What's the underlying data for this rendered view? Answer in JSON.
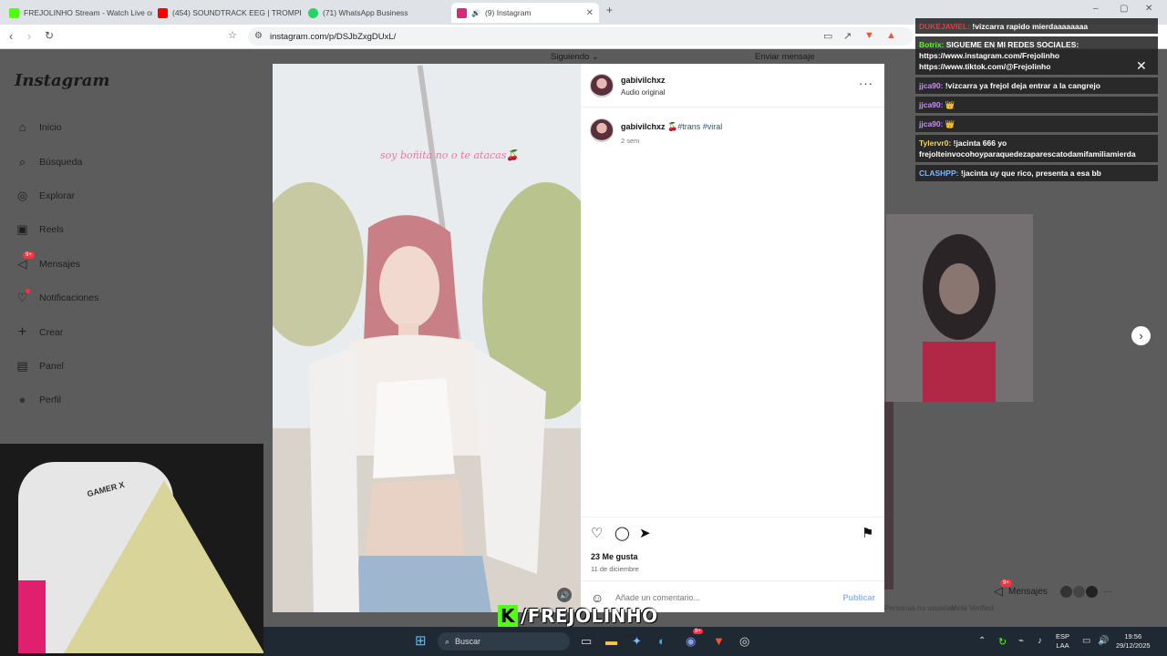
{
  "browser": {
    "tabs": [
      {
        "label": "FREJOLINHO Stream - Watch Live on",
        "color": "#53fc18"
      },
      {
        "label": "(454) SOUNDTRACK EEG | TROMPETA",
        "color": "#ff0000"
      },
      {
        "label": "(71) WhatsApp Business",
        "color": "#25d366"
      },
      {
        "label": "(9) Instagram",
        "color": "#d62976"
      }
    ],
    "url": "instagram.com/p/DSJbZxgDUxL/"
  },
  "sidebar": {
    "logo": "Instagram",
    "items": [
      {
        "label": "Inicio",
        "icon": "home-icon",
        "glyph": "⌂"
      },
      {
        "label": "Búsqueda",
        "icon": "search-icon",
        "glyph": "⌕"
      },
      {
        "label": "Explorar",
        "icon": "compass-icon",
        "glyph": "◎"
      },
      {
        "label": "Reels",
        "icon": "reels-icon",
        "glyph": "▣"
      },
      {
        "label": "Mensajes",
        "icon": "messenger-icon",
        "glyph": "◁",
        "badge": "9+"
      },
      {
        "label": "Notificaciones",
        "icon": "heart-icon",
        "glyph": "♡"
      },
      {
        "label": "Crear",
        "icon": "plus-icon",
        "glyph": "+"
      },
      {
        "label": "Panel",
        "icon": "chart-icon",
        "glyph": "▤"
      },
      {
        "label": "Perfil",
        "icon": "profile-icon",
        "glyph": "●"
      }
    ]
  },
  "topbar": {
    "following": "Siguiendo",
    "send_message": "Enviar mensaje"
  },
  "post": {
    "username": "gabivilchxz",
    "audio": "Audio original",
    "video_caption": "soy boñita no o te atacas🍒",
    "caption_user": "gabivilchxz",
    "caption_emoji": "🍒",
    "hashtags": "#trans #viral",
    "caption_time": "2 sem",
    "likes": "23 Me gusta",
    "date": "11 de diciembre",
    "comment_placeholder": "Añade un comentario...",
    "publish_label": "Publicar"
  },
  "footer": {
    "items": [
      "Personas no usuarias",
      "Meta Verified"
    ]
  },
  "messages_pill": {
    "label": "Mensajes",
    "badge": "9+"
  },
  "chat": {
    "messages": [
      {
        "user": "DUKEJAVIEL:",
        "text": "!vizcarra rapido mierdaaaaaaaa",
        "user_color": "#e23b3b"
      },
      {
        "user": "Botrix:",
        "text": "SIGUEME EN MI REDES SOCIALES: https://www.instagram.com/Frejolinho https://www.tiktok.com/@Frejolinho",
        "user_color": "#53fc18"
      },
      {
        "user": "jjca90:",
        "text": "!vizcarra ya frejol deja entrar a la cangrejo",
        "user_color": "#c98bff"
      },
      {
        "user": "jjca90:",
        "text": "👑",
        "user_color": "#c98bff"
      },
      {
        "user": "jjca90:",
        "text": "👑",
        "user_color": "#c98bff"
      },
      {
        "user": "Tylervr0:",
        "text": "!jacinta 666 yo frejolteinvocohoyparaquedezaparescatodamifamiliamierda",
        "user_color": "#f2d45c"
      },
      {
        "user": "CLASHPP:",
        "text": "!jacinta uy que rico, presenta a esa bb",
        "user_color": "#7ab8ff"
      }
    ]
  },
  "stream_brand": {
    "k": "K",
    "name": "/FREJOLINHO"
  },
  "webcam": {
    "chair_text": "GAMER X"
  },
  "taskbar": {
    "search": "Buscar",
    "lang_top": "ESP",
    "lang_bottom": "LAA",
    "time": "19:56",
    "date": "29/12/2025",
    "discord_badge": "9+"
  }
}
